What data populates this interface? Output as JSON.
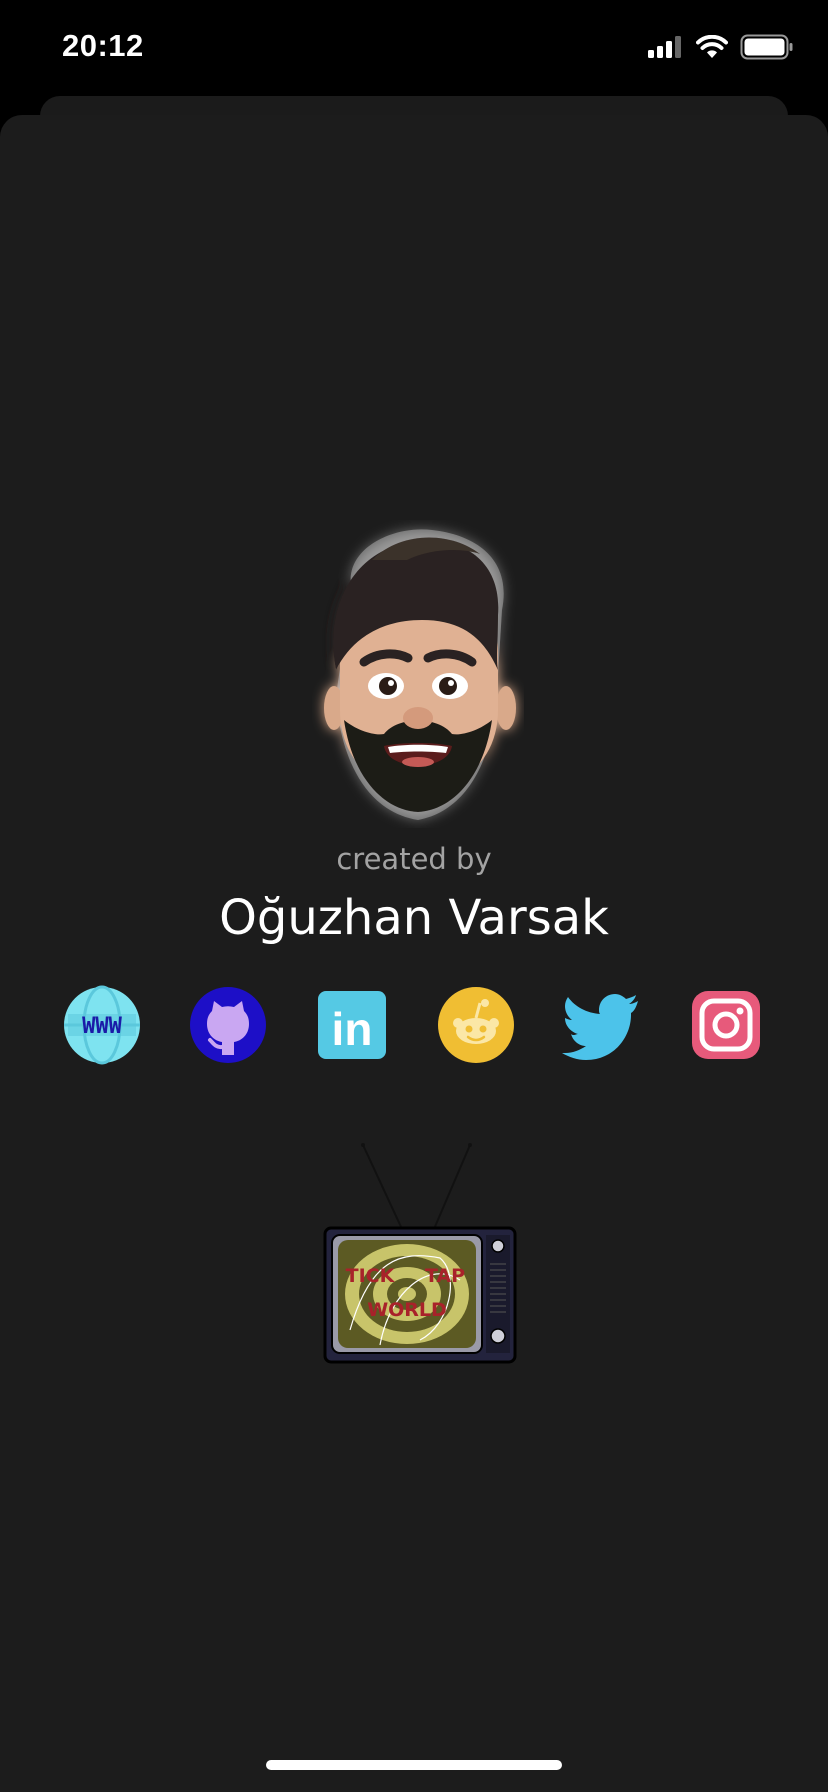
{
  "status_bar": {
    "time": "20:12",
    "icons": [
      "cellular-signal-icon",
      "wifi-icon",
      "battery-icon"
    ]
  },
  "credits": {
    "created_by_label": "created by",
    "author_name": "Oğuzhan Varsak",
    "avatar": "memoji-avatar"
  },
  "social_links": [
    {
      "name": "website",
      "icon": "www-globe-icon",
      "text": "WWW",
      "color": "#7ee3f0"
    },
    {
      "name": "github",
      "icon": "github-octocat-icon",
      "color": "#1d0fc7"
    },
    {
      "name": "linkedin",
      "icon": "linkedin-icon",
      "text": "in",
      "color": "#55c9e4"
    },
    {
      "name": "reddit",
      "icon": "reddit-alien-icon",
      "color": "#f0be33"
    },
    {
      "name": "twitter",
      "icon": "twitter-bird-icon",
      "color": "#4cc3ea"
    },
    {
      "name": "instagram",
      "icon": "instagram-camera-icon",
      "color": "#e75a7b"
    }
  ],
  "tv_image": {
    "icon": "retro-tv-icon",
    "screen_text": [
      "TICK",
      "TAP",
      "WORLD"
    ]
  },
  "colors": {
    "background": "#000000",
    "sheet": "#1c1c1c",
    "secondary_text": "#a3a3a3",
    "primary_text": "#ffffff"
  }
}
